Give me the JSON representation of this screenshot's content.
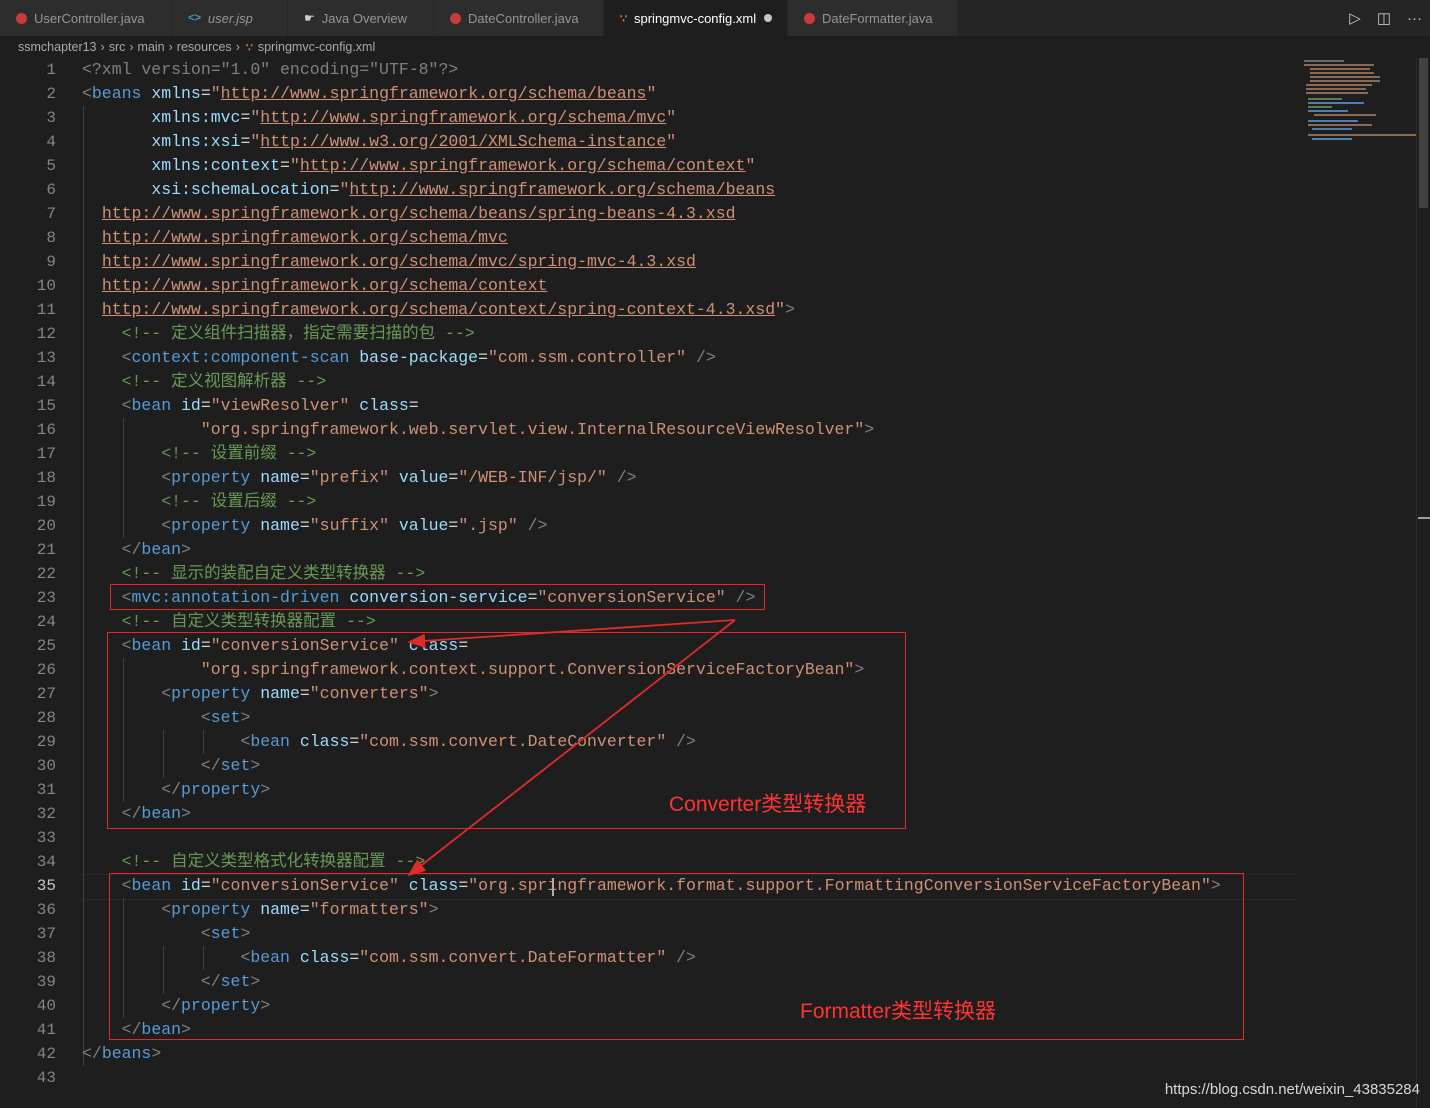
{
  "tabs": [
    {
      "label": "UserController.java",
      "icon": "java-file-icon"
    },
    {
      "label": "user.jsp",
      "icon": "jsp-file-icon"
    },
    {
      "label": "Java Overview",
      "icon": "java-overview-icon"
    },
    {
      "label": "DateController.java",
      "icon": "java-file-icon"
    },
    {
      "label": "springmvc-config.xml",
      "icon": "xml-file-icon",
      "active": true,
      "modified": true
    },
    {
      "label": "DateFormatter.java",
      "icon": "java-file-icon"
    }
  ],
  "breadcrumb": [
    "ssmchapter13",
    "src",
    "main",
    "resources",
    "springmvc-config.xml"
  ],
  "line_numbers": [
    "1",
    "2",
    "3",
    "4",
    "5",
    "6",
    "7",
    "8",
    "9",
    "10",
    "11",
    "12",
    "13",
    "14",
    "15",
    "16",
    "17",
    "18",
    "19",
    "20",
    "21",
    "22",
    "23",
    "24",
    "25",
    "26",
    "27",
    "28",
    "29",
    "30",
    "31",
    "32",
    "33",
    "34",
    "35",
    "36",
    "37",
    "38",
    "39",
    "40",
    "41",
    "42",
    "43"
  ],
  "code": {
    "l1_decl": "<?xml version=\"1.0\" encoding=\"UTF-8\"?>",
    "url_beans": "http://www.springframework.org/schema/beans",
    "url_mvc": "http://www.springframework.org/schema/mvc",
    "url_xsi": "http://www.w3.org/2001/XMLSchema-instance",
    "url_context": "http://www.springframework.org/schema/context",
    "url_beans_xsd": "http://www.springframework.org/schema/beans/spring-beans-4.3.xsd",
    "url_mvc_xsd": "http://www.springframework.org/schema/mvc/spring-mvc-4.3.xsd",
    "url_context_xsd": "http://www.springframework.org/schema/context/spring-context-4.3.xsd",
    "comment_scan": "<!-- 定义组件扫描器，指定需要扫描的包 -->",
    "scan_package": "\"com.ssm.controller\"",
    "comment_view": "<!-- 定义视图解析器 -->",
    "view_id": "\"viewResolver\"",
    "view_class": "\"org.springframework.web.servlet.view.InternalResourceViewResolver\"",
    "comment_prefix": "<!-- 设置前缀 -->",
    "prefix_name": "\"prefix\"",
    "prefix_value": "\"/WEB-INF/jsp/\"",
    "comment_suffix": "<!-- 设置后缀 -->",
    "suffix_name": "\"suffix\"",
    "suffix_value": "\".jsp\"",
    "comment_driven": "<!-- 显示的装配自定义类型转换器 -->",
    "conv_service_value": "\"conversionService\"",
    "comment_converter": "<!-- 自定义类型转换器配置 -->",
    "conv_factory_class": "\"org.springframework.context.support.ConversionServiceFactoryBean\"",
    "converters_name": "\"converters\"",
    "date_converter_class": "\"com.ssm.convert.DateConverter\"",
    "comment_formatter": "<!-- 自定义类型格式化转换器配置 -->",
    "fmt_factory_class": "\"org.springframework.format.support.FormattingConversionServiceFactoryBean\"",
    "formatters_name": "\"formatters\"",
    "date_formatter_class": "\"com.ssm.convert.DateFormatter\""
  },
  "annotations": {
    "converter_label": "Converter类型转换器",
    "formatter_label": "Formatter类型转换器",
    "color": "#e02b2b"
  },
  "watermark": "https://blog.csdn.net/weixin_43835284",
  "colors": {
    "background": "#1e1e1e",
    "tag": "#569cd6",
    "attribute": "#9cdcfe",
    "string": "#ce9178",
    "comment": "#6a9955"
  }
}
